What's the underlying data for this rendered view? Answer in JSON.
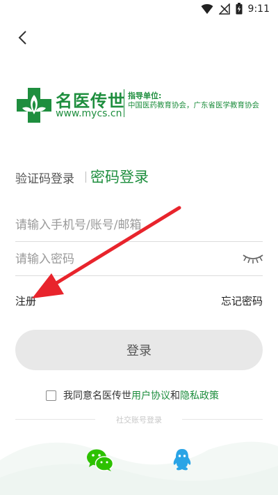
{
  "status_bar": {
    "time": "9:11"
  },
  "logo": {
    "name": "名医传世",
    "url": "www.mycs.cn",
    "guide_title": "指导单位:",
    "guide_text": "中国医药教育协会，广东省医学教育协会"
  },
  "tabs": {
    "sms": "验证码登录",
    "password": "密码登录"
  },
  "form": {
    "account_placeholder": "请输入手机号/账号/邮箱",
    "password_placeholder": "请输入密码"
  },
  "links": {
    "register": "注册",
    "forgot": "忘记密码"
  },
  "login_button": "登录",
  "agreement": {
    "prefix": "我同意名医传世",
    "user_agreement": "用户协议",
    "and": "和",
    "privacy": "隐私政策"
  },
  "social": {
    "title": "社交账号登录"
  },
  "colors": {
    "accent": "#1e8e3e",
    "arrow": "#e8242c",
    "qq": "#2aa4e6",
    "wechat": "#2dc100"
  }
}
